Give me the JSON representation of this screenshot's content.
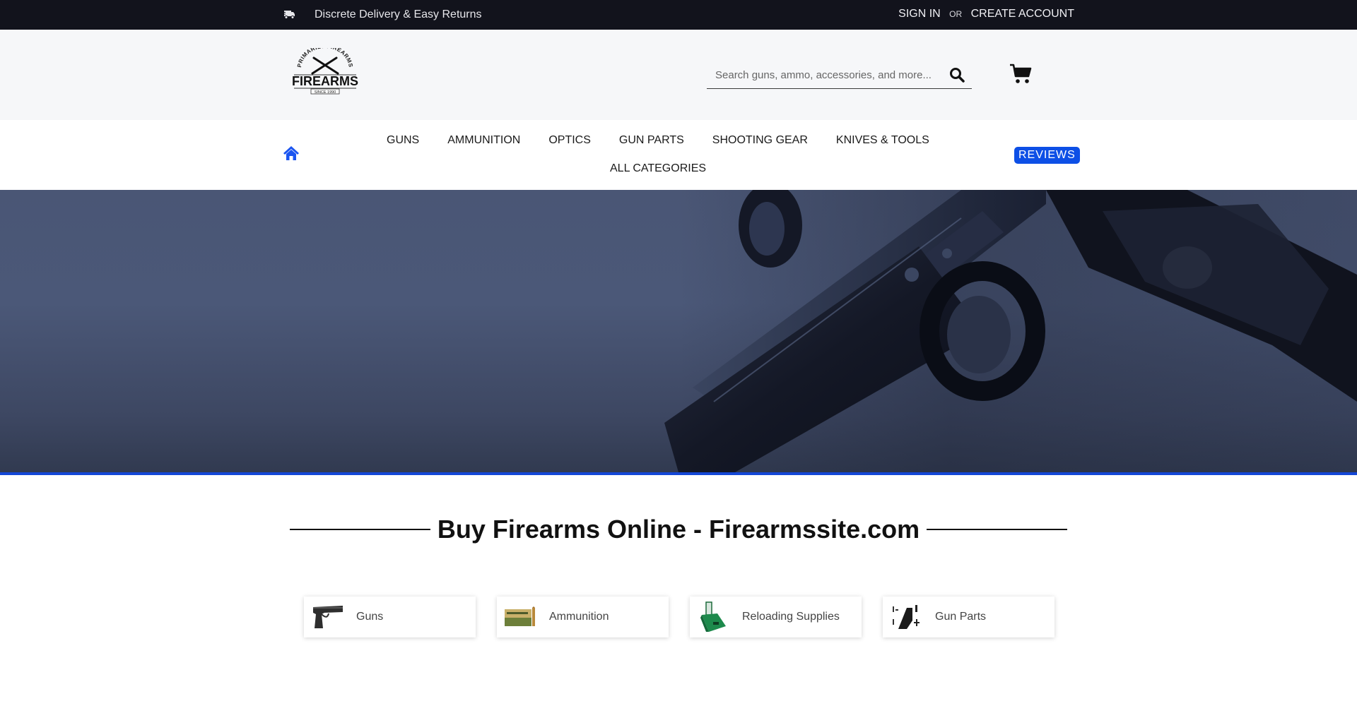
{
  "topbar": {
    "truck_icon": "delivery-truck-icon",
    "promo_text": "Discrete Delivery & Easy Returns",
    "sign_in": "SIGN IN",
    "or": "OR",
    "create_account": "CREATE ACCOUNT"
  },
  "header": {
    "logo": {
      "arc_text": "PRIMARILY FIREARMS",
      "brand": "FIREARMS",
      "since": "SINCE 1990"
    },
    "search": {
      "placeholder": "Search guns, ammo, accessories, and more...",
      "value": "",
      "icon": "search-icon"
    },
    "cart_icon": "cart-icon"
  },
  "nav": {
    "home_icon": "home-icon",
    "items": [
      {
        "label": "GUNS"
      },
      {
        "label": "AMMUNITION"
      },
      {
        "label": "OPTICS"
      },
      {
        "label": "GUN PARTS"
      },
      {
        "label": "SHOOTING GEAR"
      },
      {
        "label": "KNIVES & TOOLS"
      }
    ],
    "all_categories": "ALL CATEGORIES",
    "reviews": "REVIEWS"
  },
  "colors": {
    "accent": "#0d4fe6",
    "topbar_bg": "#12131c",
    "header_bg": "#f6f7f9",
    "hero_border": "#1447d6"
  },
  "main": {
    "title": "Buy Firearms Online - Firearmssite.com",
    "categories": [
      {
        "label": "Guns",
        "icon": "pistol-image"
      },
      {
        "label": "Ammunition",
        "icon": "ammo-box-image"
      },
      {
        "label": "Reloading Supplies",
        "icon": "powder-dispenser-image"
      },
      {
        "label": "Gun Parts",
        "icon": "gun-parts-image"
      }
    ]
  }
}
